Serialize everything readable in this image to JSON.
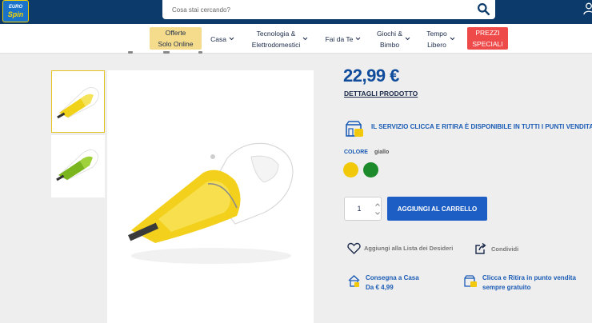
{
  "header": {
    "logo": {
      "line1": "EURO",
      "line2": "Spin",
      "line3": ""
    },
    "search": {
      "placeholder": "Cosa stai cercando?"
    }
  },
  "nav": {
    "items": [
      {
        "label_line1": "Offerte",
        "label_line2": "Solo Online",
        "chevron": false
      },
      {
        "label_line1": "Casa",
        "label_line2": "",
        "chevron": true
      },
      {
        "label_line1": "Tecnologia &",
        "label_line2": "Elettrodomestici",
        "chevron": true
      },
      {
        "label_line1": "Fai da Te",
        "label_line2": "",
        "chevron": true
      },
      {
        "label_line1": "Giochi &",
        "label_line2": "Bimbo",
        "chevron": true
      },
      {
        "label_line1": "Tempo",
        "label_line2": "Libero",
        "chevron": true
      },
      {
        "label_line1": "PREZZI",
        "label_line2": "SPECIALI",
        "chevron": false
      }
    ]
  },
  "product": {
    "price": "22,99 €",
    "details_link": "DETTAGLI PRODOTTO",
    "service_text": "IL SERVIZIO CLICCA E RITIRA  È DISPONIBILE  IN TUTTI I PUNTI VENDITA",
    "color_label": "COLORE",
    "color_value": "giallo",
    "swatches": [
      {
        "name": "giallo",
        "color": "#f2c90a"
      },
      {
        "name": "verde",
        "color": "#1c8a2a"
      }
    ],
    "quantity": "1",
    "add_to_cart": "AGGIUNGI AL CARRELLO",
    "wishlist": "Aggiungi alla Lista dei Desideri",
    "share": "Condividi",
    "shipping": {
      "home_line1": "Consegna a Casa",
      "home_line2": "Da € 4,99",
      "store_line1": "Clicca e Ritira in punto vendita",
      "store_line2": "sempre gratuito"
    }
  },
  "colors": {
    "header_bg": "#0b3a6b",
    "accent_blue": "#1d5ec4",
    "price_blue": "#0f4c9c",
    "offer_tag": "#f5dc8c",
    "special_tag": "#ef4a4a"
  }
}
